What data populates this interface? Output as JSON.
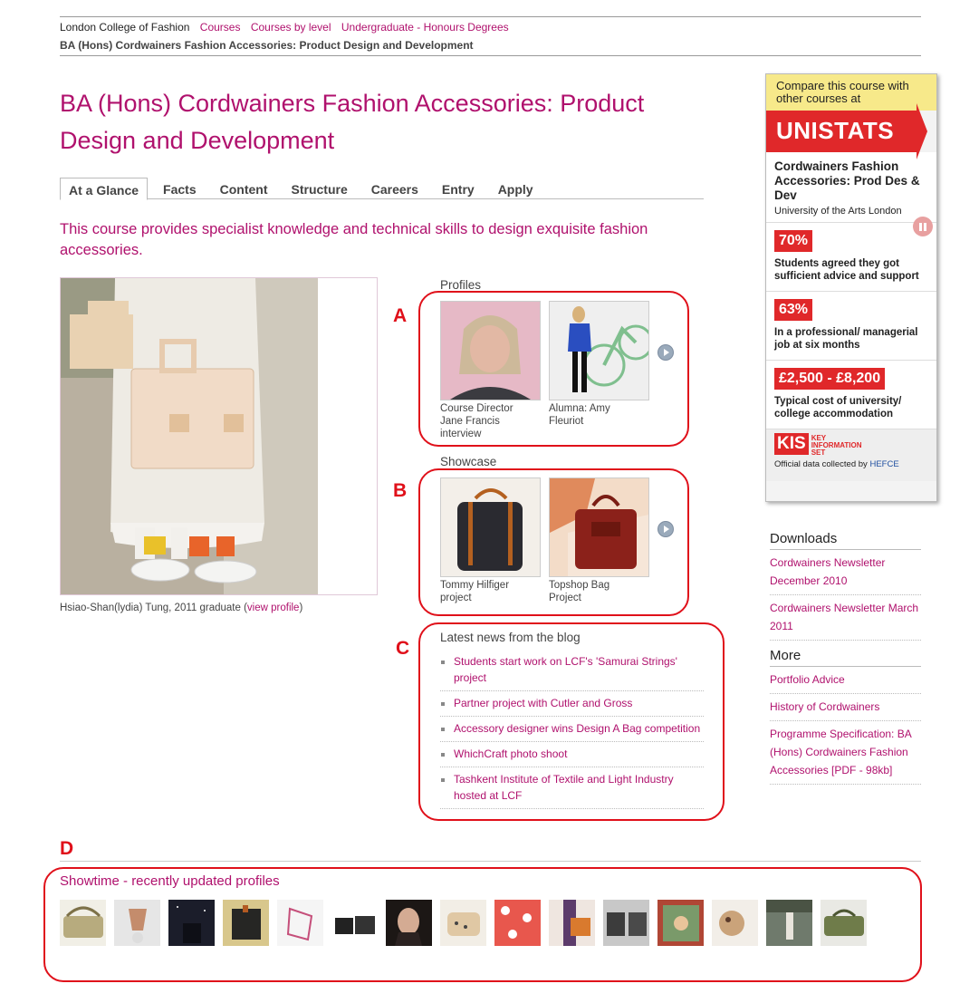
{
  "breadcrumb": {
    "root": "London College of Fashion",
    "links": [
      "Courses",
      "Courses by level",
      "Undergraduate - Honours Degrees"
    ],
    "current": "BA (Hons) Cordwainers Fashion Accessories: Product Design and Development"
  },
  "page_title": "BA (Hons) Cordwainers Fashion Accessories: Product Design and Development",
  "tabs": [
    "At a Glance",
    "Facts",
    "Content",
    "Structure",
    "Careers",
    "Entry",
    "Apply"
  ],
  "active_tab": "At a Glance",
  "intro": "This course provides specialist knowledge and technical skills to design exquisite fashion accessories.",
  "hero": {
    "caption": "Hsiao-Shan(lydia) Tung, 2011 graduate (",
    "caption_link": "view profile",
    "caption_end": ")"
  },
  "profiles": {
    "label": "Profiles",
    "items": [
      {
        "caption": "Course Director Jane Francis interview"
      },
      {
        "caption": "Alumna: Amy Fleuriot"
      }
    ]
  },
  "showcase": {
    "label": "Showcase",
    "items": [
      {
        "caption": "Tommy Hilfiger project"
      },
      {
        "caption": "Topshop Bag Project"
      }
    ]
  },
  "blog": {
    "label": "Latest news from the blog",
    "items": [
      "Students start work on LCF's 'Samurai Strings' project",
      "Partner project with Cutler and Gross",
      "Accessory designer wins Design A Bag competition",
      "WhichCraft photo shoot",
      "Tashkent Institute of Textile and Light Industry hosted at LCF"
    ]
  },
  "annotations": {
    "a": "A",
    "b": "B",
    "c": "C",
    "d": "D"
  },
  "unistats": {
    "compare_text": "Compare this course with other courses at",
    "brand": "UNISTATS",
    "course_name": "Cordwainers Fashion Accessories: Prod Des & Dev",
    "university": "University of the Arts London",
    "stats": [
      {
        "value": "70%",
        "desc": "Students agreed they got sufficient advice and support"
      },
      {
        "value": "63%",
        "desc": "In a professional/ managerial job at six months"
      },
      {
        "value": "£2,500 - £8,200",
        "desc": "Typical cost of university/ college accommodation"
      }
    ],
    "kis_badge": "KIS",
    "kis_small": "KEY INFORMATION SET",
    "official_prefix": "Official data collected by",
    "official_link": "HEFCE"
  },
  "downloads": {
    "heading": "Downloads",
    "items": [
      "Cordwainers Newsletter December 2010",
      "Cordwainers Newsletter March 2011"
    ]
  },
  "more": {
    "heading": "More",
    "items": [
      "Portfolio Advice",
      "History of Cordwainers",
      "Programme Specification: BA (Hons) Cordwainers Fashion Accessories [PDF - 98kb]"
    ]
  },
  "showtime": {
    "title": "Showtime - recently updated profiles",
    "count": 15
  },
  "colors": {
    "accent": "#b0116d",
    "annotation_red": "#e0101a",
    "unistats_red": "#e0282a",
    "unistats_yellow": "#f7e98a"
  }
}
